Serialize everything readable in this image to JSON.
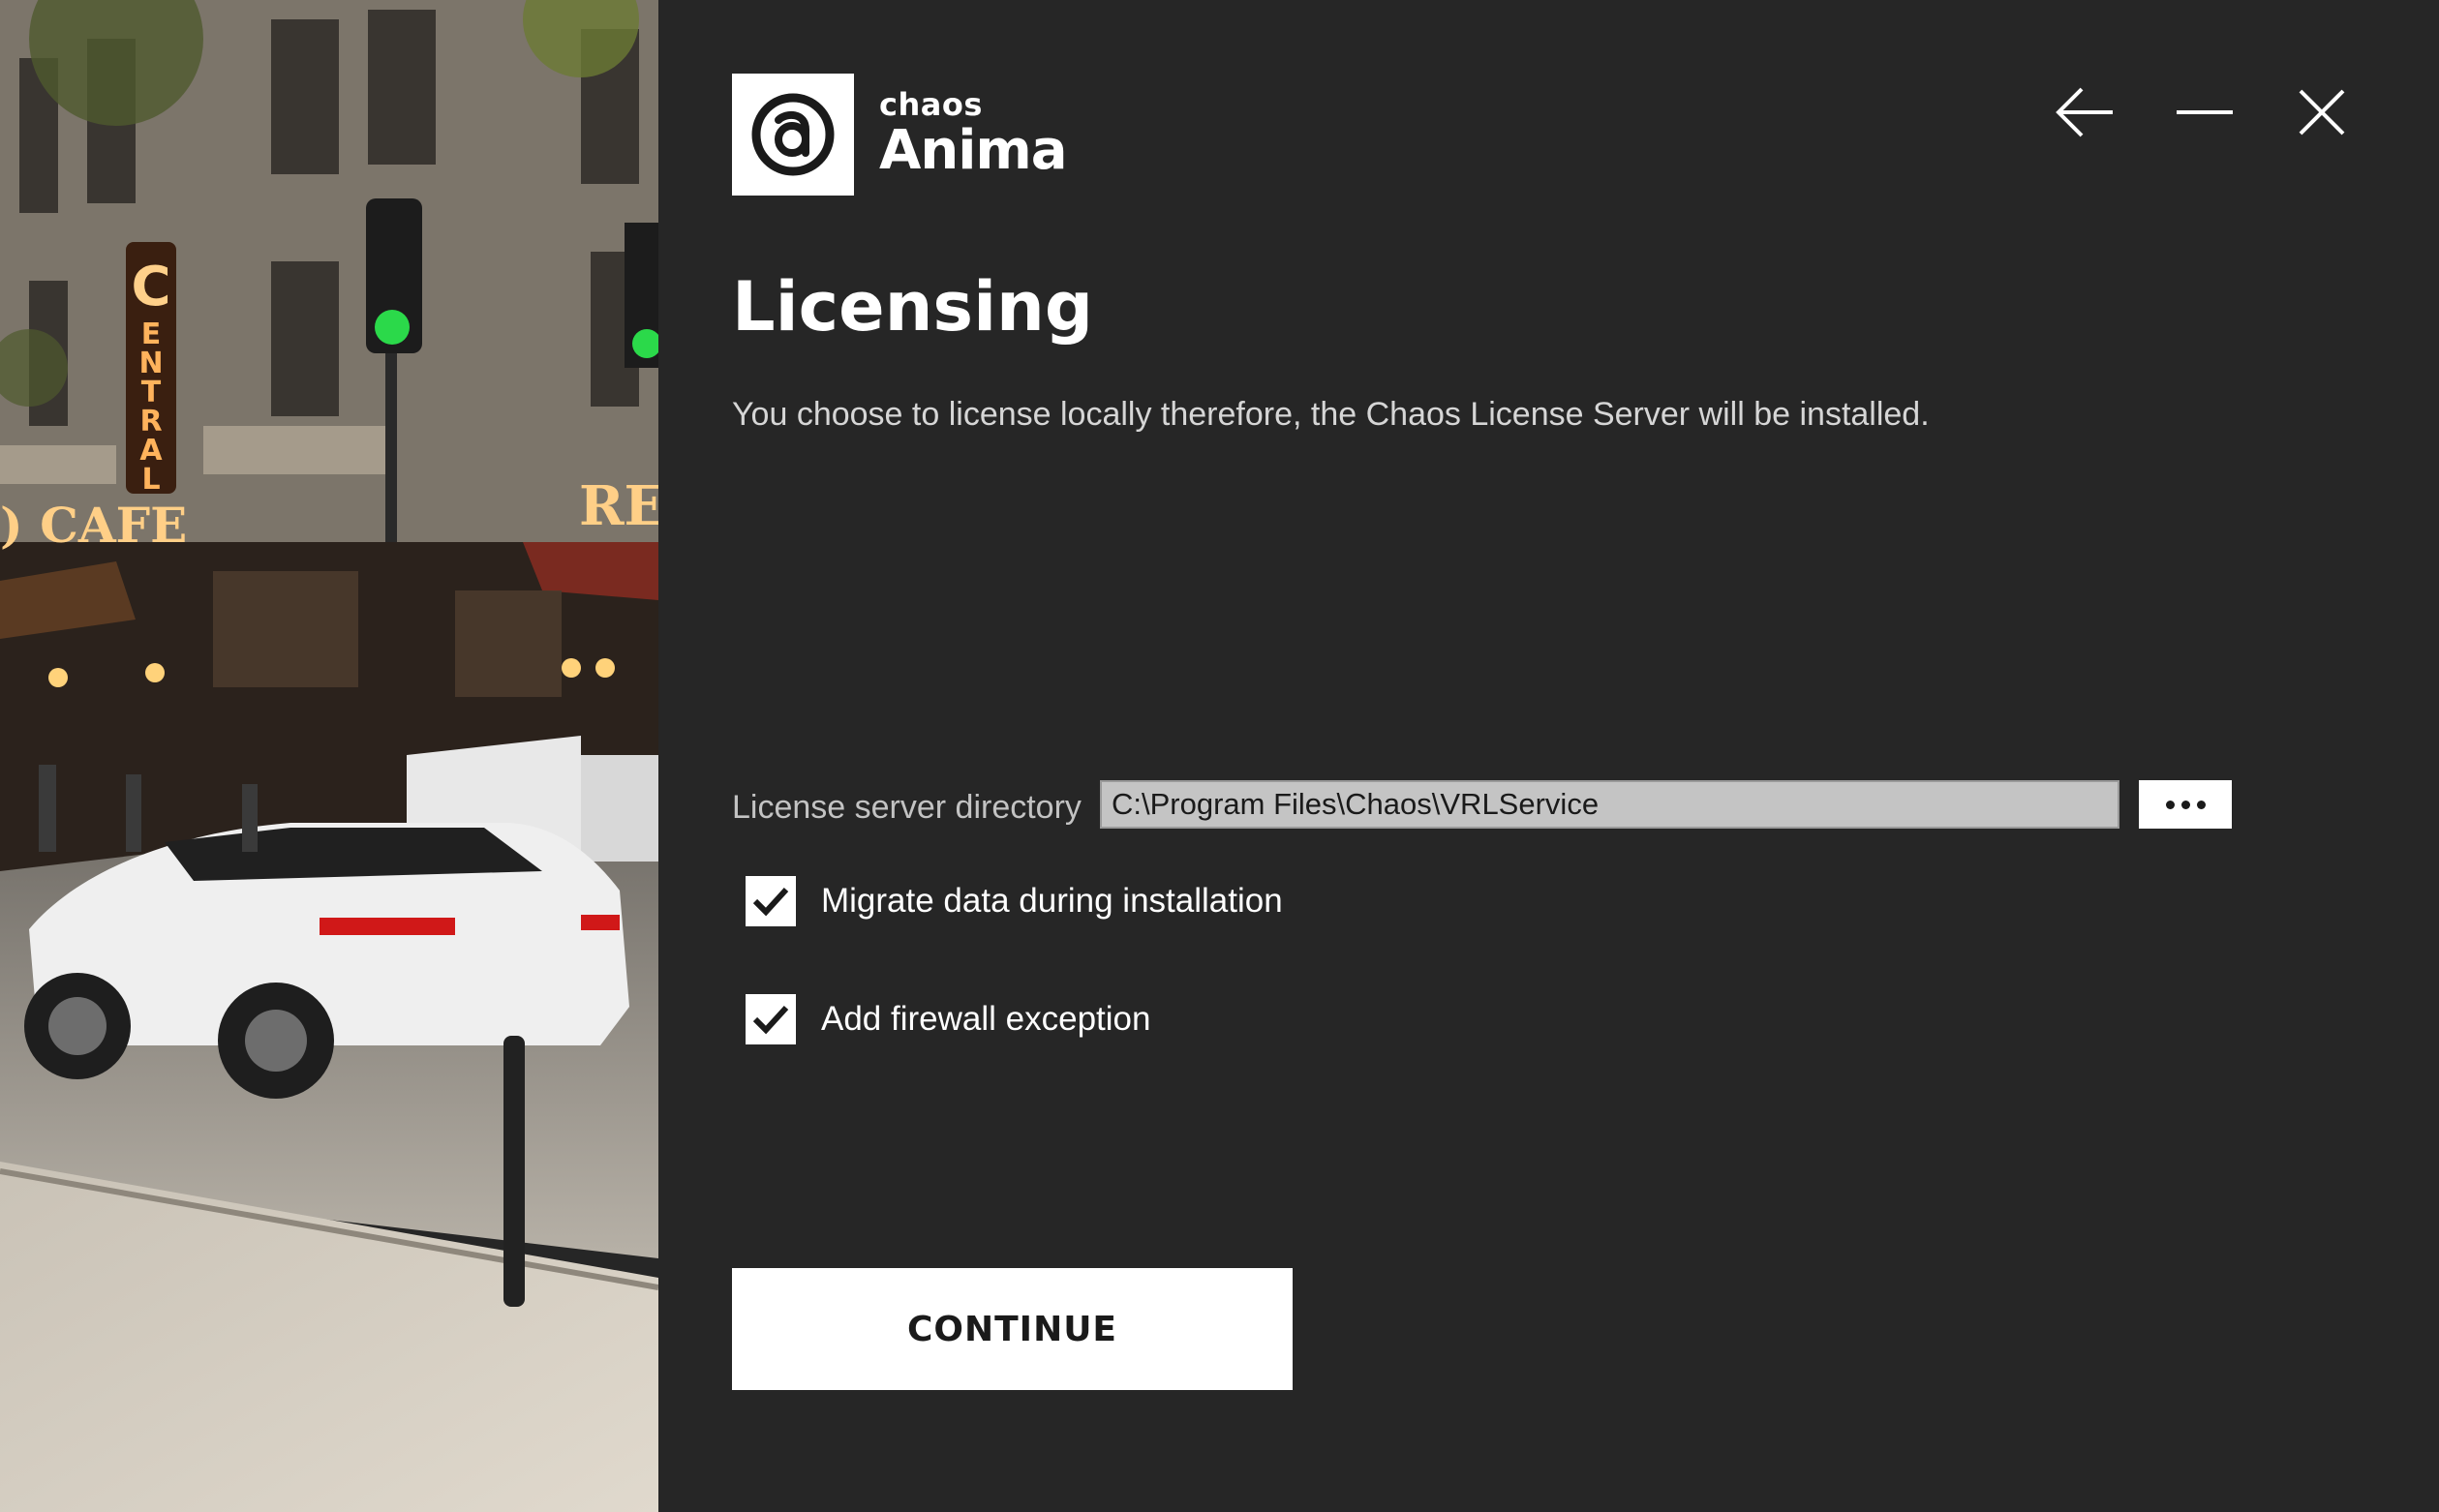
{
  "app": {
    "brand_small": "chaos",
    "brand_big": "Anima"
  },
  "window_controls": {
    "back_icon": "arrow-left-icon",
    "minimize_icon": "minimize-icon",
    "close_icon": "close-icon"
  },
  "page": {
    "title": "Licensing",
    "description": "You choose to license locally therefore, the Chaos License Server will be installed."
  },
  "license_directory": {
    "label": "License server directory",
    "value": "C:\\Program Files\\Chaos\\VRLService",
    "browse_icon": "more-dots-icon"
  },
  "options": [
    {
      "label": "Migrate data during installation",
      "checked": true
    },
    {
      "label": "Add firewall exception",
      "checked": true
    }
  ],
  "actions": {
    "continue_label": "CONTINUE"
  },
  "hero_image": {
    "signs": [
      "CENTRAL",
      "CAFE",
      "RE"
    ]
  },
  "colors": {
    "background": "#262626",
    "text_primary": "#ffffff",
    "text_secondary": "#c3c3c3",
    "button_bg": "#ffffff",
    "input_bg": "#c4c4c4"
  }
}
